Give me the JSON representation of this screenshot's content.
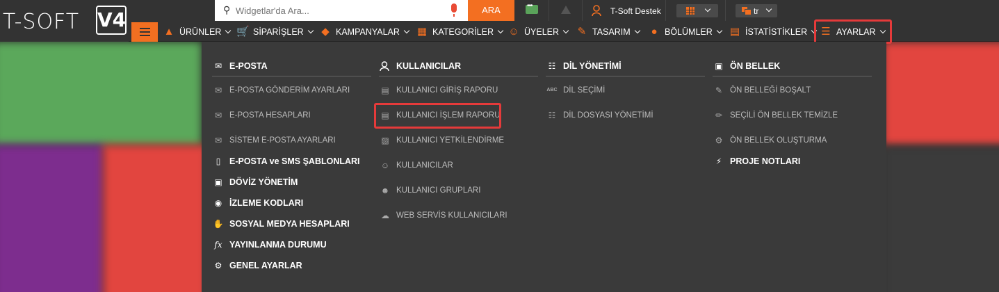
{
  "logo": {
    "text": "T-SOFT",
    "version": "V4"
  },
  "search": {
    "placeholder": "Widgetlar'da Ara...",
    "button": "ARA"
  },
  "user": {
    "name": "T-Soft Destek"
  },
  "language": {
    "selected": "tr"
  },
  "nav": [
    {
      "label": "ÜRÜNLER",
      "icon": "shirt-icon"
    },
    {
      "label": "SİPARİŞLER",
      "icon": "cart-icon"
    },
    {
      "label": "KAMPANYALAR",
      "icon": "tag-icon"
    },
    {
      "label": "KATEGORİLER",
      "icon": "sitemap-icon"
    },
    {
      "label": "ÜYELER",
      "icon": "users-icon"
    },
    {
      "label": "TASARIM",
      "icon": "brush-icon"
    },
    {
      "label": "BÖLÜMLER",
      "icon": "sections-icon"
    },
    {
      "label": "İSTATİSTİKLER",
      "icon": "chart-icon"
    },
    {
      "label": "AYARLAR",
      "icon": "settings-list-icon"
    }
  ],
  "menu": {
    "col1": {
      "heading": "E-POSTA",
      "items": [
        "E-POSTA GÖNDERİM AYARLARI",
        "E-POSTA HESAPLARI",
        "SİSTEM E-POSTA AYARLARI"
      ],
      "subheads": [
        "E-POSTA ve SMS ŞABLONLARI",
        "DÖVİZ YÖNETİM",
        "İZLEME KODLARI",
        "SOSYAL MEDYA HESAPLARI",
        "YAYINLANMA DURUMU",
        "GENEL AYARLAR"
      ]
    },
    "col2": {
      "heading": "KULLANICILAR",
      "items": [
        "KULLANICI GİRİŞ RAPORU",
        "KULLANICI İŞLEM RAPORU",
        "KULLANICI YETKİLENDİRME",
        "KULLANICILAR",
        "KULLANICI GRUPLARI",
        "WEB SERVİS KULLANICILARI"
      ]
    },
    "col3": {
      "heading": "DİL YÖNETİMİ",
      "items": [
        "DİL SEÇİMİ",
        "DİL DOSYASI YÖNETİMİ"
      ]
    },
    "col4": {
      "heading": "ÖN BELLEK",
      "items": [
        "ÖN BELLEĞİ BOŞALT",
        "SEÇİLİ ÖN BELLEK TEMİZLE",
        "ÖN BELLEK OLUŞTURMA"
      ],
      "subheads": [
        "PROJE NOTLARI"
      ]
    }
  },
  "colors": {
    "accent": "#f36f21",
    "highlight": "#e53a3a",
    "panel": "#3a3a3a",
    "bar": "#333333"
  }
}
